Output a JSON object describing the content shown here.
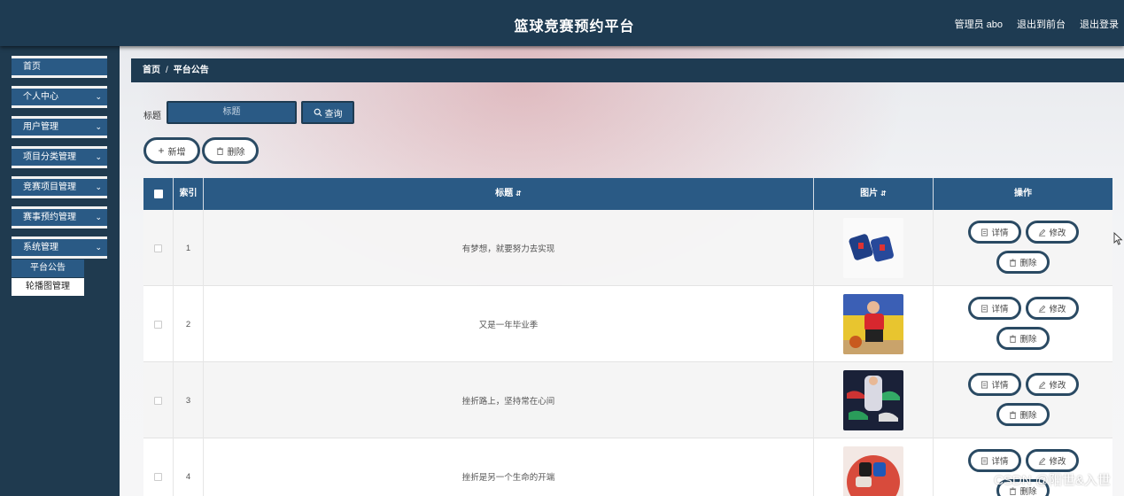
{
  "header": {
    "title": "篮球竞赛预约平台",
    "admin_label": "管理员 abo",
    "back_front": "退出到前台",
    "logout": "退出登录"
  },
  "sidebar": {
    "items": [
      {
        "label": "首页",
        "has_chevron": false
      },
      {
        "label": "个人中心",
        "has_chevron": true
      },
      {
        "label": "用户管理",
        "has_chevron": true
      },
      {
        "label": "项目分类管理",
        "has_chevron": true
      },
      {
        "label": "竞赛项目管理",
        "has_chevron": true
      },
      {
        "label": "赛事预约管理",
        "has_chevron": true
      },
      {
        "label": "系统管理",
        "has_chevron": true
      }
    ],
    "sub_items": [
      {
        "label": "平台公告",
        "active": true
      },
      {
        "label": "轮播图管理",
        "active": false
      }
    ]
  },
  "breadcrumb": {
    "home": "首页",
    "separator": "/",
    "current": "平台公告"
  },
  "search": {
    "label": "标题",
    "placeholder": "标题",
    "button": "查询"
  },
  "toolbar": {
    "add": "新增",
    "delete": "删除"
  },
  "table": {
    "columns": {
      "index": "索引",
      "title": "标题",
      "image": "图片",
      "actions": "操作"
    },
    "rows": [
      {
        "index": "1",
        "title": "有梦想，就要努力去实现",
        "image": "wristbands"
      },
      {
        "index": "2",
        "title": "又是一年毕业季",
        "image": "player-dribbling"
      },
      {
        "index": "3",
        "title": "挫折路上，坚持常在心间",
        "image": "sneakers-poster"
      },
      {
        "index": "4",
        "title": "挫折是另一个生命的开端",
        "image": "ball-wristbands"
      }
    ],
    "row_actions": {
      "detail": "详情",
      "edit": "修改",
      "delete": "删除"
    }
  },
  "watermark": "CSDN @阳世&入世",
  "colors": {
    "header_bg": "#1e3b52",
    "accent": "#2a5a85",
    "sidebar_bg": "#1f3a4f"
  }
}
